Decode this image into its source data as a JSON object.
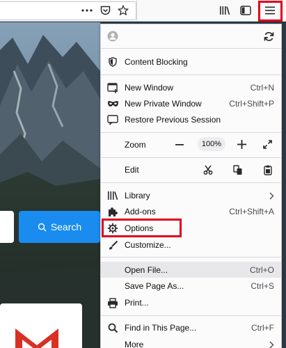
{
  "toolbar": {
    "more_icon": "more-horizontal-icon",
    "pocket_icon": "pocket-icon",
    "bookmark_icon": "star-icon",
    "library_icon": "library-icon",
    "sidebar_icon": "sidebar-icon",
    "menu_icon": "hamburger-menu-icon"
  },
  "newtab": {
    "search_button": "Search"
  },
  "menu": {
    "content_blocking": "Content Blocking",
    "new_window": "New Window",
    "new_window_shortcut": "Ctrl+N",
    "new_private_window": "New Private Window",
    "new_private_window_shortcut": "Ctrl+Shift+P",
    "restore_session": "Restore Previous Session",
    "zoom": "Zoom",
    "zoom_level": "100%",
    "edit": "Edit",
    "library": "Library",
    "addons": "Add-ons",
    "addons_shortcut": "Ctrl+Shift+A",
    "options": "Options",
    "customize": "Customize...",
    "open_file": "Open File...",
    "open_file_shortcut": "Ctrl+O",
    "save_page": "Save Page As...",
    "save_page_shortcut": "Ctrl+S",
    "print": "Print...",
    "find_in_page": "Find in This Page...",
    "find_in_page_shortcut": "Ctrl+F",
    "more": "More"
  },
  "colors": {
    "highlight": "#e0001a",
    "search_button": "#1a8cf0"
  }
}
